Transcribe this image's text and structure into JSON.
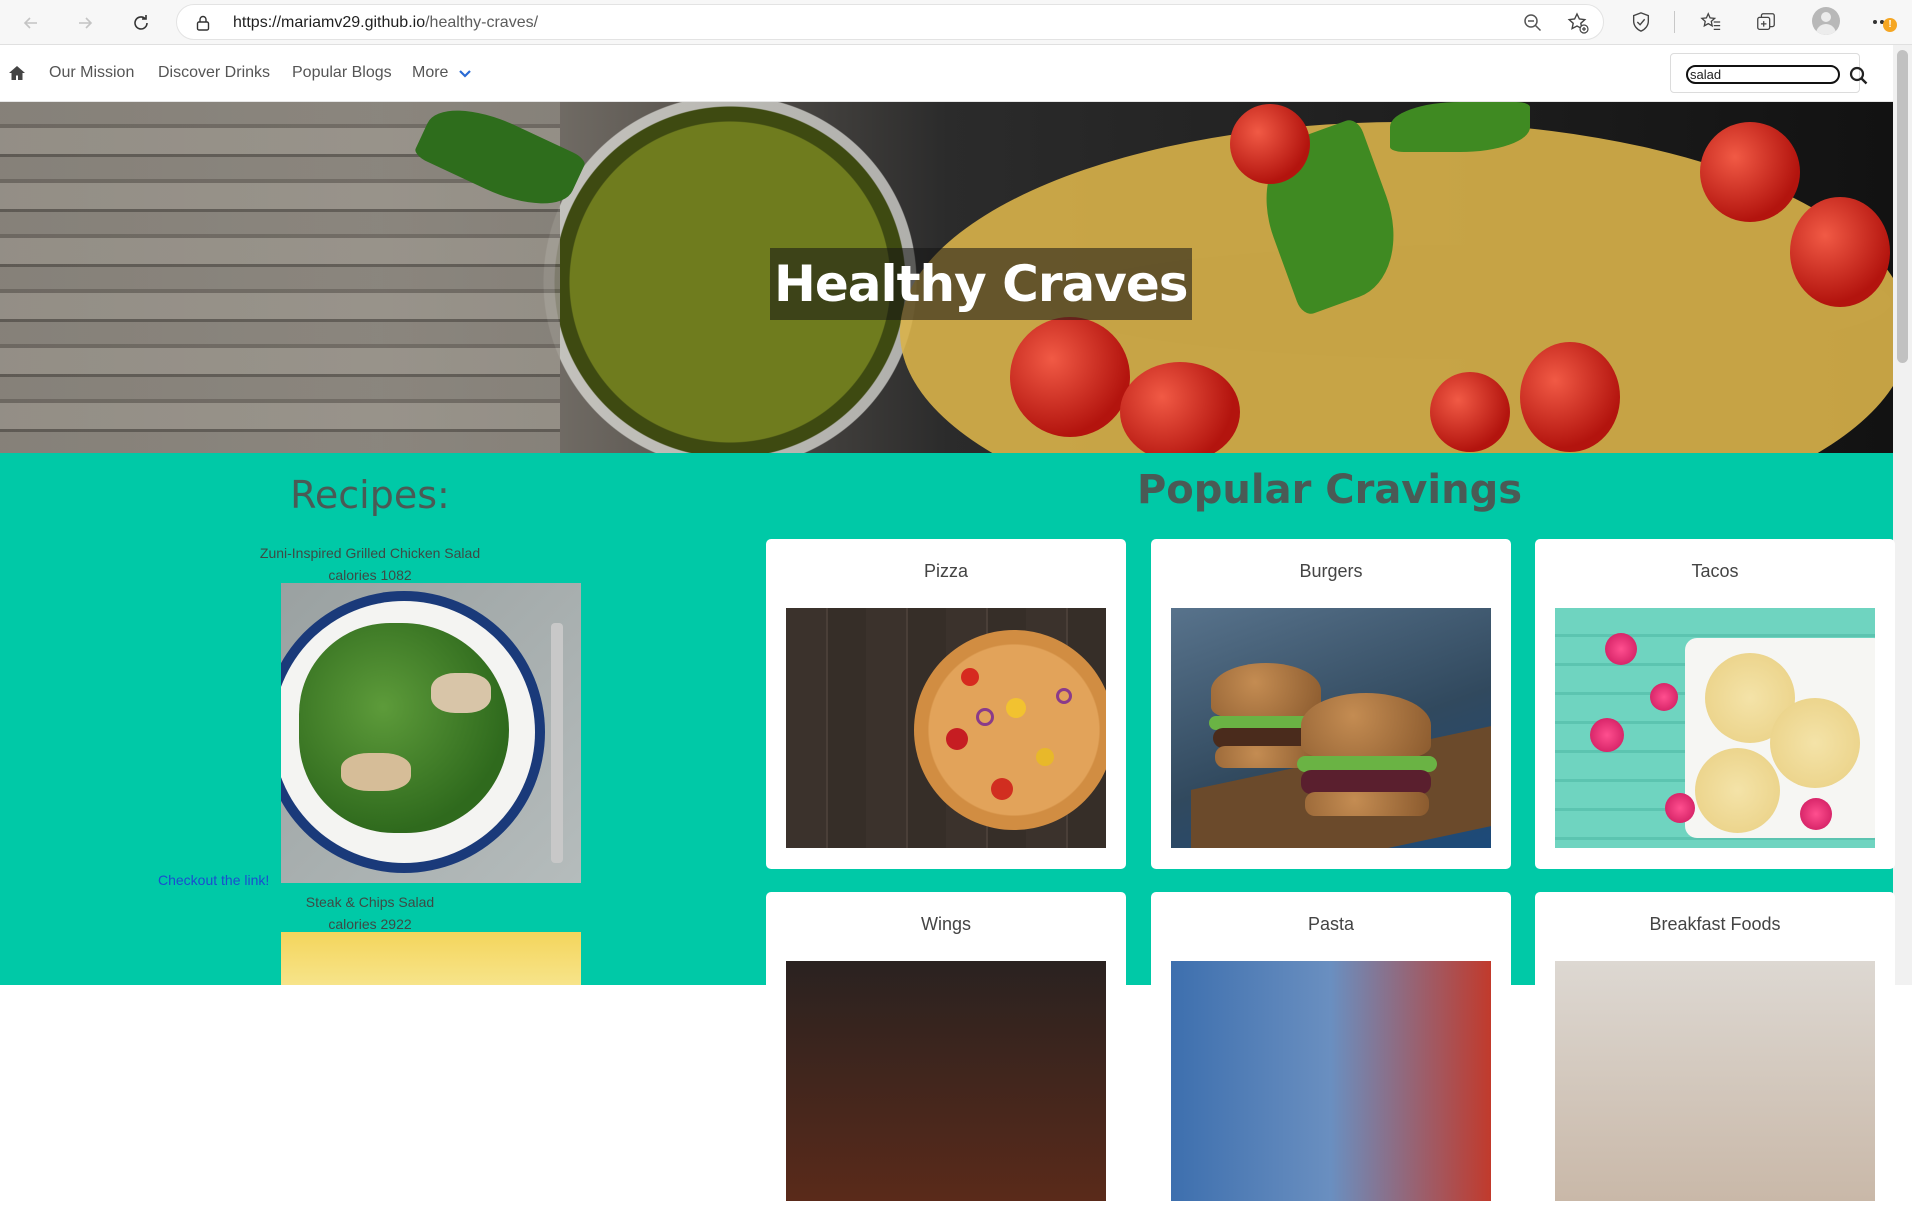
{
  "browser": {
    "url_host": "https://mariamv29.github.io",
    "url_path": "/healthy-craves/",
    "notification_badge": "!"
  },
  "nav": {
    "links": [
      "Our Mission",
      "Discover Drinks",
      "Popular Blogs",
      "More"
    ],
    "search_value": "salad"
  },
  "hero": {
    "title": "Healthy Craves"
  },
  "recipes": {
    "heading": "Recipes:",
    "items": [
      {
        "name": "Zuni-Inspired Grilled Chicken Salad",
        "calories": "calories 1082",
        "link_text": "Checkout the link!"
      },
      {
        "name": "Steak & Chips Salad",
        "calories": "calories 2922"
      }
    ]
  },
  "popular": {
    "heading": "Popular Cravings",
    "cards": [
      "Pizza",
      "Burgers",
      "Tacos",
      "Wings",
      "Pasta",
      "Breakfast Foods"
    ]
  },
  "colors": {
    "main_bg": "#00c9a7",
    "link": "#1a4dd0"
  }
}
